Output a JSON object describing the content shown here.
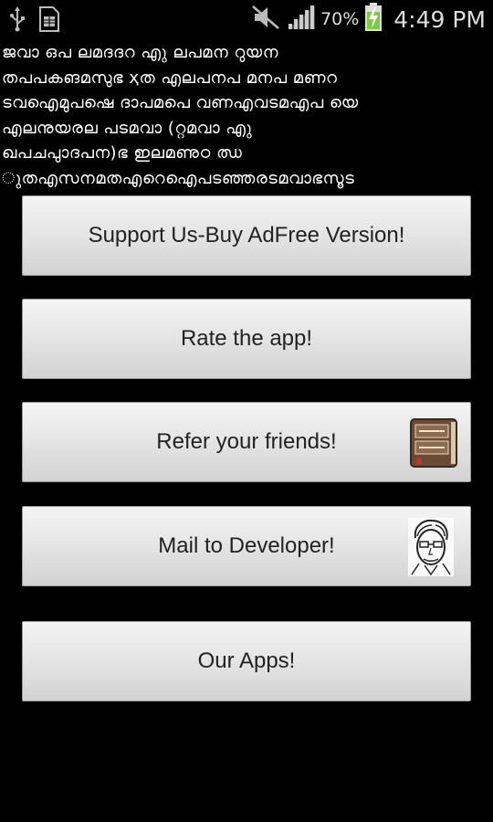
{
  "status_bar": {
    "icons_left": [
      "usb-icon",
      "sim-card-icon"
    ],
    "icons_right": [
      "mute-icon",
      "signal-icon",
      "battery-charging-icon"
    ],
    "battery_percent": "70%",
    "time": "4:49 PM"
  },
  "content_text": {
    "lines": [
      "ജവാ ഒപ ലമദദറ എു ലപമന റുയന",
      "തപപകങമസുഭ ҳത എലപനപ മനപ മണറ",
      "ടവഐമുപഷെ ദാപമപെ വണഎവടമഎപ യെ",
      "എലനുയരല പടമവാ (റ്റമവാ എു",
      "ഖപചപാുദപന)ഭ ഇലമണുഠ ഝ",
      "ുതഎസനമതഎറെഐപടഞ്ഞരടമവാഭസൂട"
    ]
  },
  "buttons": {
    "support_label": "Support Us-Buy AdFree Version!",
    "rate_label": "Rate the app!",
    "refer_label": "Refer your friends!",
    "refer_icon": "bible-book-icon",
    "mail_label": "Mail to Developer!",
    "mail_icon": "developer-face-icon",
    "apps_label": "Our Apps!"
  },
  "colors": {
    "background": "#000000",
    "button_top": "#f4f4f4",
    "button_bottom": "#d2d2d2",
    "button_text": "#222222",
    "battery_green": "#7ec843"
  }
}
